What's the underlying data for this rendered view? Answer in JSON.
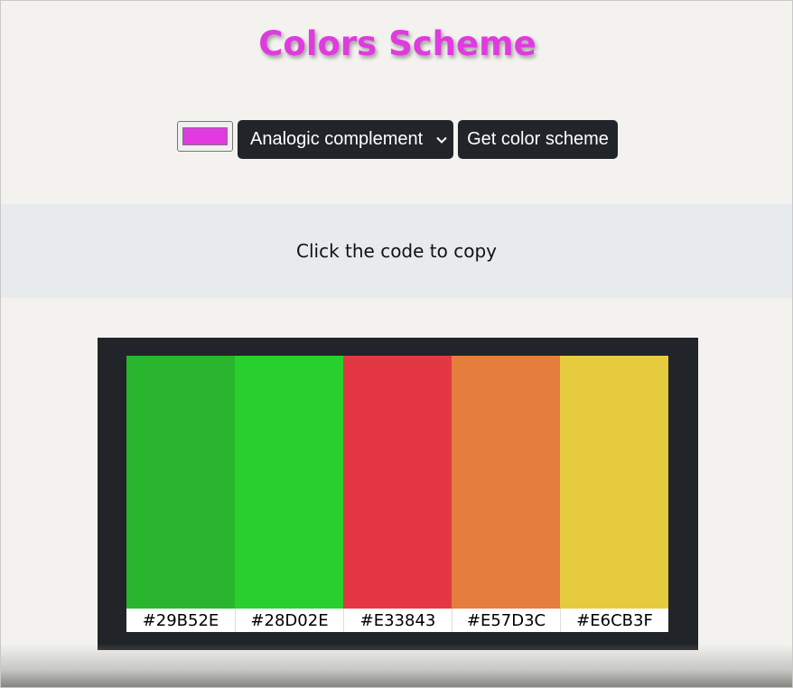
{
  "header": {
    "title": "Colors Scheme",
    "title_color": "#e03ae0"
  },
  "controls": {
    "seed_color": "#e03ae0",
    "mode_selected": "Analogic complement",
    "mode_icon": "chevron-down-icon",
    "submit_label": "Get color scheme"
  },
  "hint": {
    "text": "Click the code to copy"
  },
  "palette": {
    "colors": [
      {
        "hex": "#29B52E",
        "label": "#29B52E"
      },
      {
        "hex": "#28D02E",
        "label": "#28D02E"
      },
      {
        "hex": "#E33843",
        "label": "#E33843"
      },
      {
        "hex": "#E57D3C",
        "label": "#E57D3C"
      },
      {
        "hex": "#E6CB3F",
        "label": "#E6CB3F"
      }
    ]
  }
}
